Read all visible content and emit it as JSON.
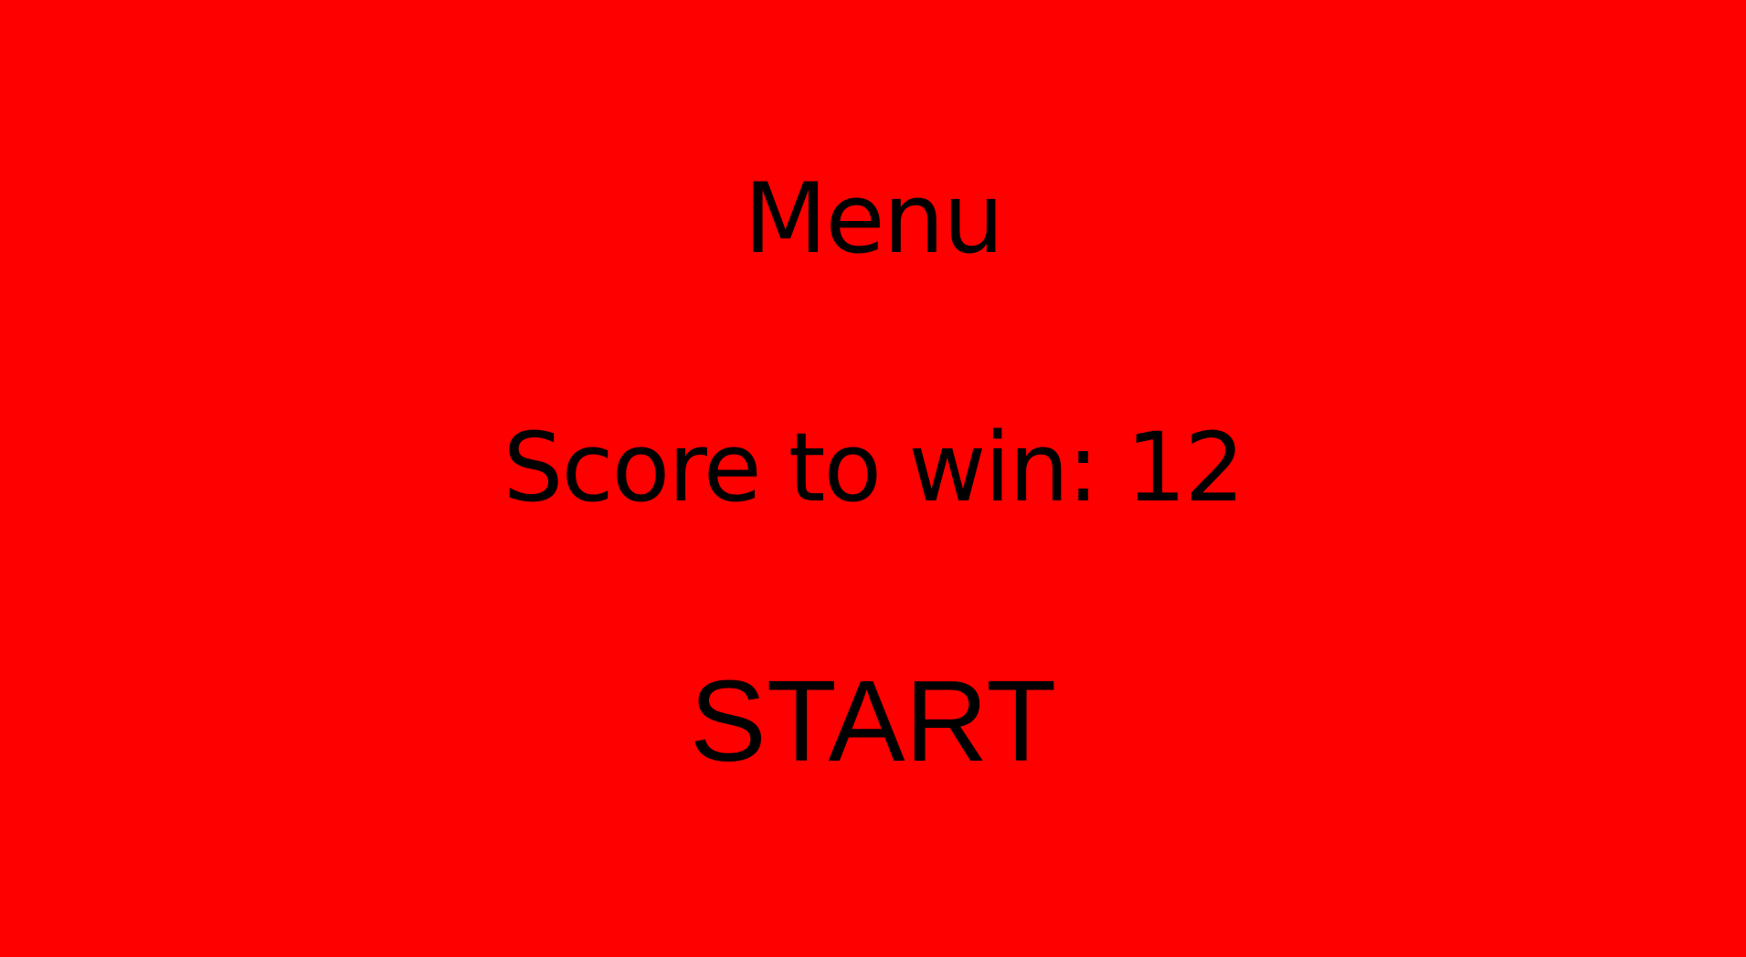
{
  "colors": {
    "background": "#ff0000",
    "text": "#000000"
  },
  "menu": {
    "title": "Menu",
    "score_to_win_label": "Score to win: 12",
    "score_to_win_value": 12,
    "start_label": "START"
  }
}
